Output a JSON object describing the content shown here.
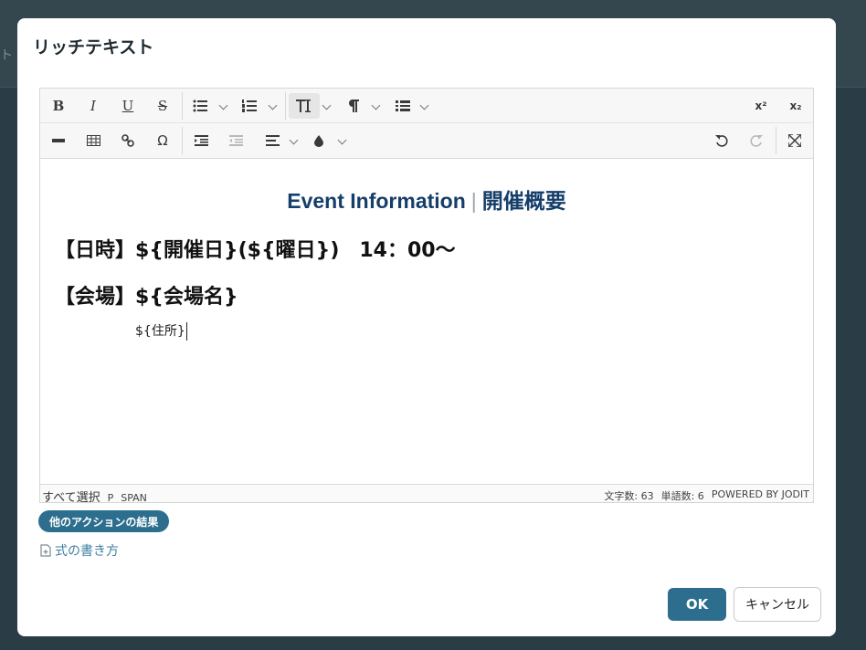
{
  "background": {
    "fragment": "ト"
  },
  "modal": {
    "title": "リッチテキスト"
  },
  "toolbar": {
    "bold": "B",
    "italic": "I",
    "underline": "U",
    "strikethrough": "S",
    "special_char": "Ω",
    "superscript": "x²",
    "subscript": "x₂"
  },
  "content": {
    "heading_en": "Event Information",
    "heading_sep": "|",
    "heading_ja": "開催概要",
    "line1": "【日時】${開催日}(${曜日})　14：00〜",
    "line2": "【会場】${会場名}",
    "address": "${住所}"
  },
  "statusbar": {
    "select_all": "すべて選択",
    "path_p": "P",
    "path_span": "SPAN",
    "char_count": "文字数: 63",
    "word_count": "単語数: 6",
    "powered_by": "POWERED BY JODIT"
  },
  "actions": {
    "other_action_results": "他のアクションの結果",
    "formula_help": "式の書き方"
  },
  "buttons": {
    "ok": "OK",
    "cancel": "キャンセル"
  },
  "colors": {
    "accent": "#2d6e8e",
    "heading": "#163e6a",
    "link": "#3f7fa2"
  }
}
